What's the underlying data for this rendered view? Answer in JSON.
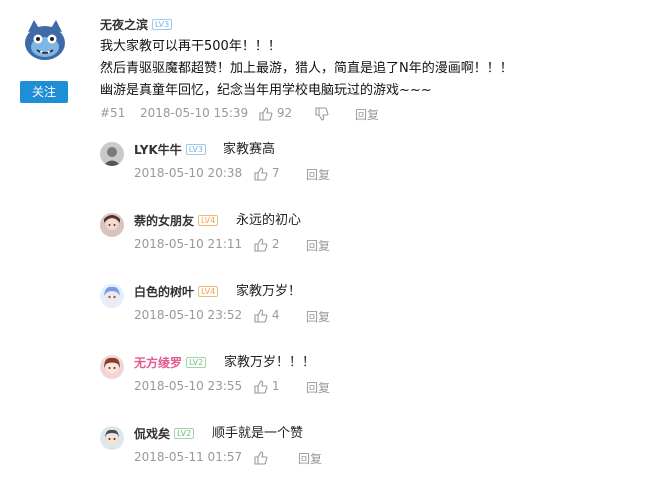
{
  "main_comment": {
    "username": "无夜之滨",
    "level": "LV3",
    "follow_label": "关注",
    "lines": [
      "我大家教可以再干500年！！！",
      "然后青驱驱魔都超赞！加上最游，猎人，简直是追了N年的漫画啊！！！",
      "幽游是真童年回忆，纪念当年用学校电脑玩过的游戏~~~"
    ],
    "floor": "#51",
    "time": "2018-05-10 15:39",
    "likes": "92",
    "reply_label": "回复"
  },
  "replies": [
    {
      "username": "LYK牛牛",
      "level": "LV3",
      "text": "家教赛高",
      "time": "2018-05-10 20:38",
      "likes": "7",
      "reply_label": "回复"
    },
    {
      "username": "萘的女朋友",
      "level": "LV4",
      "text": "永远的初心",
      "time": "2018-05-10 21:11",
      "likes": "2",
      "reply_label": "回复"
    },
    {
      "username": "白色的树叶",
      "level": "LV4",
      "text": "家教万岁！",
      "time": "2018-05-10 23:52",
      "likes": "4",
      "reply_label": "回复"
    },
    {
      "username": "无方绫罗",
      "level": "LV2",
      "text": "家教万岁！！！",
      "time": "2018-05-10 23:55",
      "likes": "1",
      "reply_label": "回复"
    },
    {
      "username": "侃戏矣",
      "level": "LV2",
      "text": "顺手就是一个赞",
      "time": "2018-05-11 01:57",
      "likes": "",
      "reply_label": "回复"
    }
  ]
}
